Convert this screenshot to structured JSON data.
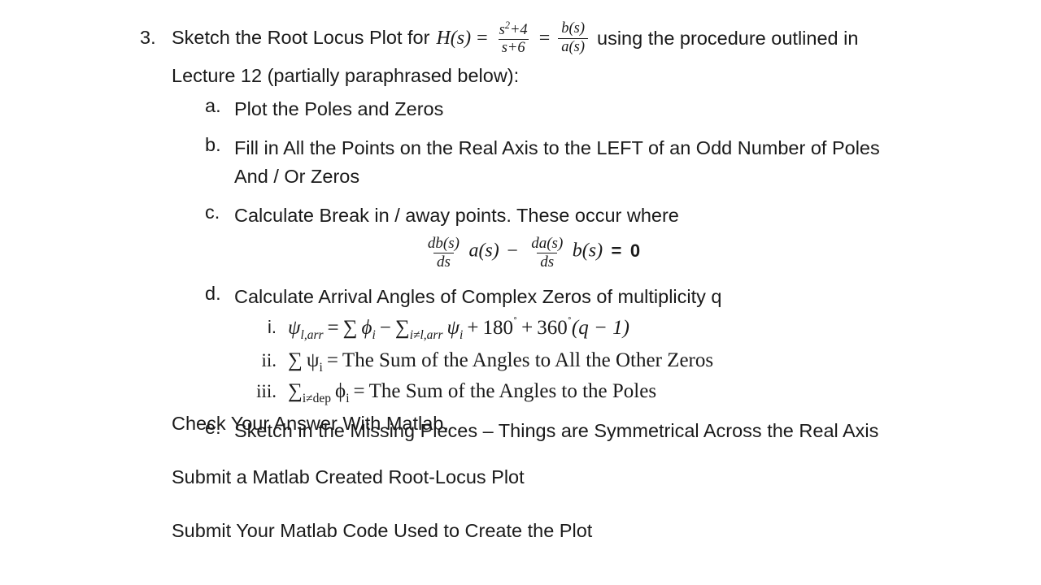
{
  "document": {
    "background_color": "#ffffff",
    "text_color": "#1a1a1a"
  },
  "problem": {
    "number": "3.",
    "line1_prefix": "Sketch the Root Locus Plot for",
    "function_name": "H(s)",
    "equals_1": "=",
    "fraction_1": {
      "numerator": "s",
      "numerator_exponent": "2",
      "numerator_rest": "+4",
      "denominator": "s+6"
    },
    "equals_2": "=",
    "fraction_2": {
      "numerator": "b(s)",
      "denominator": "a(s)"
    },
    "line1_suffix": "using the procedure outlined in",
    "line2": "Lecture 12 (partially paraphrased below):"
  },
  "steps": [
    {
      "marker": "a.",
      "text": "Plot the Poles and Zeros"
    },
    {
      "marker": "b.",
      "text": "Fill in All the Points on the Real Axis to the LEFT of an Odd Number of Poles And / Or Zeros"
    },
    {
      "marker": "c.",
      "text": "Calculate Break in / away points. These occur where"
    },
    {
      "marker": "d.",
      "text": "Calculate Arrival Angles of Complex Zeros of multiplicity q"
    },
    {
      "marker": "e.",
      "text": "Sketch in the Missing Pieces – Things are Symmetrical Across the Real Axis"
    }
  ],
  "break_equation": {
    "frac1": {
      "numerator": "db(s)",
      "denominator": "ds"
    },
    "term1": "a(s)",
    "operator": "−",
    "frac2": {
      "numerator": "da(s)",
      "denominator": "ds"
    },
    "term2": "b(s)",
    "equals": "=",
    "result": "0"
  },
  "substeps": [
    {
      "marker": "i.",
      "parts": {
        "lhs_symbol": "ψ",
        "lhs_sub": "l,arr",
        "equals": "=",
        "sum1": "∑",
        "phi": "ϕ",
        "phi_sub": "i",
        "minus": "−",
        "sum2": "∑",
        "sum2_sub": "i≠l,arr",
        "psi": "ψ",
        "psi_sub": "i",
        "plus1": "+",
        "angle1": "180",
        "degree1": "˚",
        "plus2": "+",
        "angle2": "360",
        "degree2": "˚",
        "tail": "(q − 1)"
      }
    },
    {
      "marker": "ii.",
      "parts": {
        "sum": "∑",
        "psi": "ψ",
        "psi_sub": "i",
        "equals": "=",
        "description": "The Sum of the Angles to All the Other Zeros"
      }
    },
    {
      "marker": "iii.",
      "parts": {
        "sum": "∑",
        "sum_sub": "i≠dep",
        "phi": "ϕ",
        "phi_sub": "i",
        "equals": "=",
        "description": "The Sum of the Angles to the Poles"
      }
    }
  ],
  "closing": [
    "Check Your Answer With Matlab.",
    "Submit a Matlab Created Root-Locus Plot",
    "Submit Your Matlab Code Used to Create the Plot"
  ]
}
